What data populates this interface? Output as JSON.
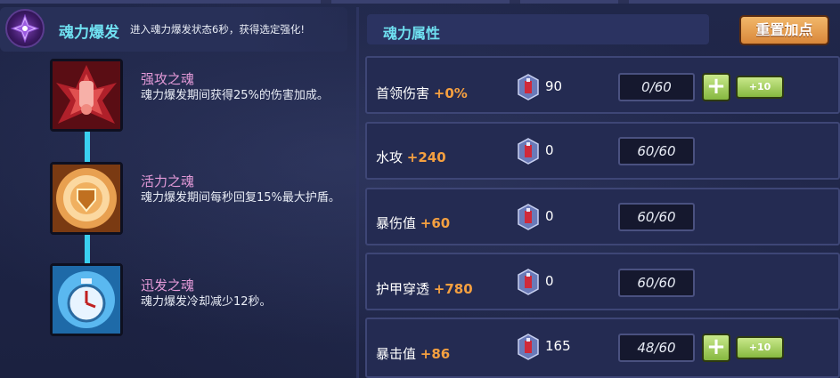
{
  "header": {
    "title": "魂力爆发",
    "description": "进入魂力爆发状态6秒，获得选定强化!"
  },
  "skills": [
    {
      "name": "强攻之魂",
      "desc": "魂力爆发期间获得25%的伤害加成。",
      "icon": "attack-soul-icon"
    },
    {
      "name": "活力之魂",
      "desc": "魂力爆发期间每秒回复15%最大护盾。",
      "icon": "vitality-soul-icon"
    },
    {
      "name": "迅发之魂",
      "desc": "魂力爆发冷却减少12秒。",
      "icon": "swift-soul-icon"
    }
  ],
  "attributes_panel": {
    "title": "魂力属性",
    "reset_label": "重置加点"
  },
  "attributes": [
    {
      "name": "首领伤害",
      "bonus": "+0%",
      "gems": "90",
      "level": "0/60",
      "plus": "+",
      "plus10": "+10"
    },
    {
      "name": "水攻",
      "bonus": "+240",
      "gems": "0",
      "level": "60/60"
    },
    {
      "name": "暴伤值",
      "bonus": "+60",
      "gems": "0",
      "level": "60/60"
    },
    {
      "name": "护甲穿透",
      "bonus": "+780",
      "gems": "0",
      "level": "60/60"
    },
    {
      "name": "暴击值",
      "bonus": "+86",
      "gems": "165",
      "level": "48/60",
      "plus": "+",
      "plus10": "+10"
    }
  ],
  "colors": {
    "accent_cyan": "#6fe0f0",
    "bonus_orange": "#f5a040",
    "skill_name_pink": "#e39ad8",
    "reset_orange": "#d9873a",
    "plus_green": "#86b840"
  }
}
